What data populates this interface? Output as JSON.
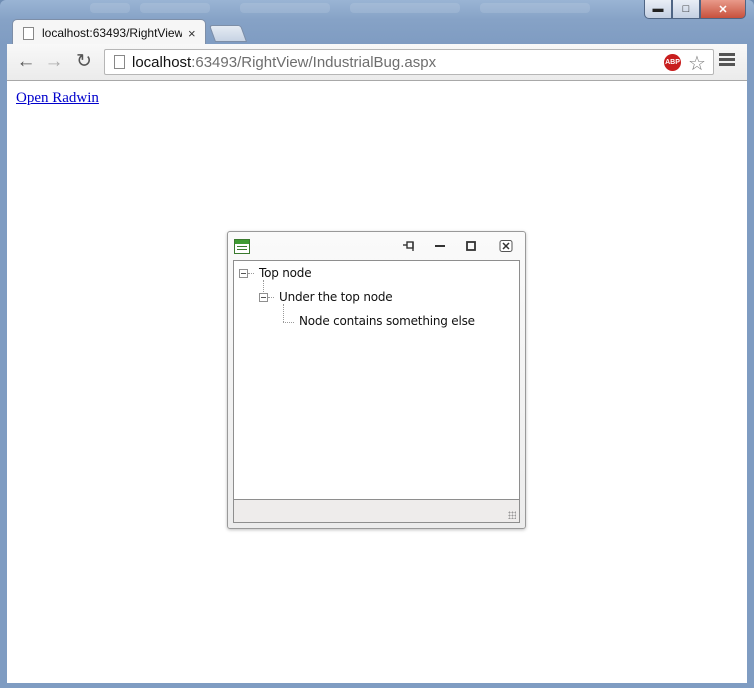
{
  "browser": {
    "tab_title": "localhost:63493/RightView",
    "tab_close": "×",
    "address_host": "localhost",
    "address_rest": ":63493/RightView/IndustrialBug.aspx",
    "abp_label": "ABP",
    "back_icon": "back-arrow-icon",
    "forward_icon": "forward-arrow-icon",
    "reload_icon": "reload-icon"
  },
  "page": {
    "open_link": "Open Radwin"
  },
  "radwindow": {
    "tree": [
      {
        "label": "Top node"
      },
      {
        "label": "Under the top node"
      },
      {
        "label": "Node contains something else"
      }
    ]
  },
  "colors": {
    "link": "#0000cc",
    "window_frame": "#86a2c6",
    "radwindow_icon_green": "#3f9b32"
  }
}
